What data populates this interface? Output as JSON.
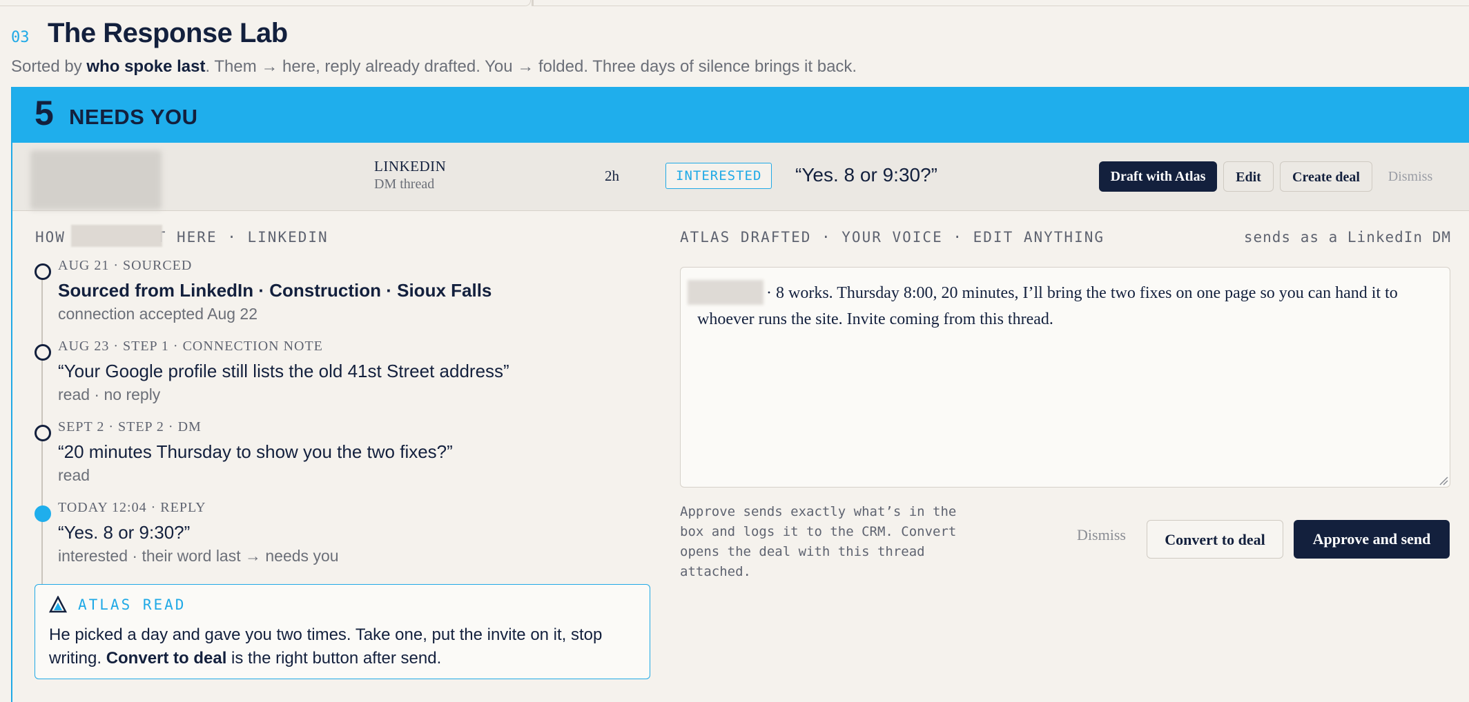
{
  "section": {
    "number": "03",
    "title": "The Response Lab",
    "subtitle_pre": "Sorted by ",
    "subtitle_bold": "who spoke last",
    "subtitle_post": ". Them → here, reply already drafted. You → folded. Three days of silence brings it back."
  },
  "banner": {
    "count": "5",
    "label": "NEEDS YOU"
  },
  "thread_row": {
    "channel": "LINKEDIN",
    "channel_sub": "DM thread",
    "age": "2h",
    "status_badge": "INTERESTED",
    "last_message": "“Yes. 8 or 9:30?”",
    "actions": {
      "draft": "Draft with Atlas",
      "edit": "Edit",
      "create_deal": "Create deal",
      "dismiss": "Dismiss"
    }
  },
  "history": {
    "heading_pre": "HOW ",
    "heading_post": "OT HERE · LINKEDIN",
    "events": [
      {
        "meta": "AUG 21 · SOURCED",
        "title": "Sourced from LinkedIn · Construction · Sioux Falls",
        "sub": "connection accepted Aug 22"
      },
      {
        "meta": "AUG 23 · STEP 1 · CONNECTION NOTE",
        "title": "“Your Google profile still lists the old 41st Street address”",
        "sub": "read · no reply"
      },
      {
        "meta": "SEPT 2 · STEP 2 · DM",
        "title": "“20 minutes Thursday to show you the two fixes?”",
        "sub": "read"
      },
      {
        "meta": "TODAY 12:04 · REPLY",
        "title": "“Yes. 8 or 9:30?”",
        "sub": "interested · their word last → needs you"
      }
    ]
  },
  "atlas_read": {
    "heading": "ATLAS READ",
    "text_pre": "He picked a day and gave you two times. Take one, put the invite on it, stop writing. ",
    "text_bold": "Convert to deal",
    "text_post": " is the right button after send."
  },
  "draft": {
    "heading": "ATLAS DRAFTED · YOUR VOICE · EDIT ANYTHING",
    "sends_as": "sends as a LinkedIn DM",
    "body": "· 8 works. Thursday 8:00, 20 minutes, I’ll bring the two fixes on one page so you can hand it to whoever runs the site. Invite coming from this thread.",
    "help": "Approve sends exactly what’s in the box and logs it to the CRM. Convert opens the deal with this thread attached.",
    "actions": {
      "dismiss": "Dismiss",
      "convert": "Convert to deal",
      "approve": "Approve and send"
    }
  },
  "colors": {
    "accent": "#1faeec",
    "navy": "#13203d",
    "background": "#f5f2ed"
  }
}
